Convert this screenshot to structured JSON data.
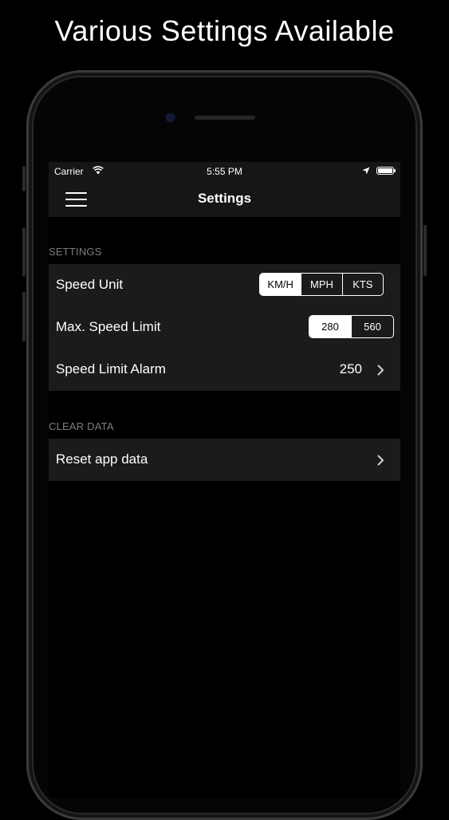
{
  "headline": "Various Settings Available",
  "status_bar": {
    "carrier": "Carrier",
    "time": "5:55 PM"
  },
  "nav": {
    "title": "Settings"
  },
  "sections": {
    "settings_header": "SETTINGS",
    "clear_header": "CLEAR DATA"
  },
  "speed_unit": {
    "label": "Speed Unit",
    "options": [
      "KM/H",
      "MPH",
      "KTS"
    ],
    "selected": "KM/H"
  },
  "max_speed": {
    "label": "Max. Speed Limit",
    "options": [
      "280",
      "560"
    ],
    "selected": "280"
  },
  "alarm": {
    "label": "Speed Limit Alarm",
    "value": "250"
  },
  "reset": {
    "label": "Reset app data"
  },
  "icons": [
    "hamburger-menu-icon",
    "wifi-icon",
    "location-arrow-icon",
    "battery-icon",
    "chevron-right-icon"
  ],
  "colors": {
    "background": "#000000",
    "bar": "#161616",
    "cell": "#1b1b1b",
    "section_text": "#7d7d7d",
    "text": "#ffffff"
  }
}
